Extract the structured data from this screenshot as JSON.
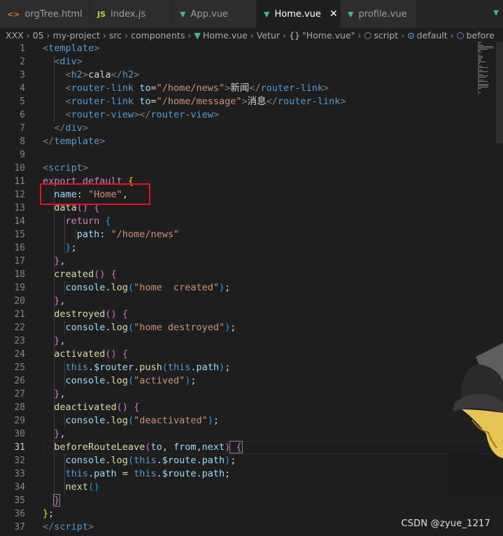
{
  "tabs": [
    {
      "label": "orgTree.html",
      "icon": "html-file-icon",
      "icon_glyph": "<>",
      "active": false
    },
    {
      "label": "index.js",
      "icon": "js-file-icon",
      "icon_glyph": "JS",
      "active": false
    },
    {
      "label": "App.vue",
      "icon": "vue-file-icon",
      "icon_glyph": "▼",
      "active": false
    },
    {
      "label": "Home.vue",
      "icon": "vue-file-icon",
      "icon_glyph": "▼",
      "active": true,
      "close_glyph": "✕"
    },
    {
      "label": "profile.vue",
      "icon": "vue-file-icon",
      "icon_glyph": "▼",
      "active": false
    }
  ],
  "tabbar_right_glyph": "▼",
  "breadcrumb": [
    {
      "label": "XXX"
    },
    {
      "label": "05"
    },
    {
      "label": "my-project"
    },
    {
      "label": "src"
    },
    {
      "label": "components"
    },
    {
      "label": "Home.vue",
      "icon": "vue-file-icon",
      "glyph": "▼"
    },
    {
      "label": "Vetur"
    },
    {
      "label": "\"Home.vue\"",
      "icon": "braces-icon",
      "glyph": "{}"
    },
    {
      "label": "script",
      "icon": "cube-icon",
      "glyph": "⬡"
    },
    {
      "label": "default",
      "icon": "field-icon",
      "glyph": "⊙"
    },
    {
      "label": "before",
      "icon": "method-icon",
      "glyph": "⬡"
    }
  ],
  "breadcrumb_separator": "›",
  "line_numbers": [
    "1",
    "2",
    "3",
    "4",
    "5",
    "6",
    "7",
    "8",
    "9",
    "10",
    "11",
    "12",
    "13",
    "14",
    "15",
    "16",
    "17",
    "18",
    "19",
    "20",
    "21",
    "22",
    "23",
    "24",
    "25",
    "26",
    "27",
    "28",
    "29",
    "30",
    "31",
    "32",
    "33",
    "34",
    "35",
    "36",
    "37"
  ],
  "current_line": "31",
  "code_lines": [
    [
      [
        "t-bracket",
        "<"
      ],
      [
        "t-tag",
        "template"
      ],
      [
        "t-bracket",
        ">"
      ]
    ],
    [
      [
        "",
        "  "
      ],
      [
        "t-bracket",
        "<"
      ],
      [
        "t-tag",
        "div"
      ],
      [
        "t-bracket",
        ">"
      ]
    ],
    [
      [
        "",
        "    "
      ],
      [
        "t-bracket",
        "<"
      ],
      [
        "t-tag",
        "h2"
      ],
      [
        "t-bracket",
        ">"
      ],
      [
        "",
        "cala"
      ],
      [
        "t-bracket",
        "</"
      ],
      [
        "t-tag",
        "h2"
      ],
      [
        "t-bracket",
        ">"
      ]
    ],
    [
      [
        "",
        "    "
      ],
      [
        "t-bracket",
        "<"
      ],
      [
        "t-tag",
        "router-link"
      ],
      [
        "",
        ""
      ],
      [
        "t-attr",
        " to"
      ],
      [
        "",
        "="
      ],
      [
        "t-str",
        "\"/home/news\""
      ],
      [
        "t-bracket",
        ">"
      ],
      [
        "",
        "新闻"
      ],
      [
        "t-bracket",
        "</"
      ],
      [
        "t-tag",
        "router-link"
      ],
      [
        "t-bracket",
        ">"
      ]
    ],
    [
      [
        "",
        "    "
      ],
      [
        "t-bracket",
        "<"
      ],
      [
        "t-tag",
        "router-link"
      ],
      [
        "t-attr",
        " to"
      ],
      [
        "",
        "="
      ],
      [
        "t-str",
        "\"/home/message\""
      ],
      [
        "t-bracket",
        ">"
      ],
      [
        "",
        "消息"
      ],
      [
        "t-bracket",
        "</"
      ],
      [
        "t-tag",
        "router-link"
      ],
      [
        "t-bracket",
        ">"
      ]
    ],
    [
      [
        "",
        "    "
      ],
      [
        "t-bracket",
        "<"
      ],
      [
        "t-tag",
        "router-view"
      ],
      [
        "t-bracket",
        "></"
      ],
      [
        "t-tag",
        "router-view"
      ],
      [
        "t-bracket",
        ">"
      ]
    ],
    [
      [
        "",
        "  "
      ],
      [
        "t-bracket",
        "</"
      ],
      [
        "t-tag",
        "div"
      ],
      [
        "t-bracket",
        ">"
      ]
    ],
    [
      [
        "t-bracket",
        "</"
      ],
      [
        "t-tag",
        "template"
      ],
      [
        "t-bracket",
        ">"
      ]
    ],
    [],
    [
      [
        "t-bracket",
        "<"
      ],
      [
        "t-tag",
        "script"
      ],
      [
        "t-bracket",
        ">"
      ]
    ],
    [
      [
        "t-kw",
        "export default "
      ],
      [
        "t-brace1",
        "{"
      ]
    ],
    [
      [
        "t-var",
        "  name"
      ],
      [
        "",
        ": "
      ],
      [
        "t-str",
        "\"Home\""
      ],
      [
        "",
        ","
      ]
    ],
    [
      [
        "t-fn",
        "  data"
      ],
      [
        "t-brace2",
        "()"
      ],
      [
        "",
        ""
      ],
      [
        "t-brace2",
        " {"
      ]
    ],
    [
      [
        "t-kw",
        "    return "
      ],
      [
        "t-brace3",
        "{"
      ]
    ],
    [
      [
        "t-var",
        "      path"
      ],
      [
        "",
        ": "
      ],
      [
        "t-str",
        "\"/home/news\""
      ]
    ],
    [
      [
        "t-brace3",
        "    }"
      ],
      [
        "",
        ";"
      ]
    ],
    [
      [
        "t-brace2",
        "  }"
      ],
      [
        "",
        ","
      ]
    ],
    [
      [
        "t-fn",
        "  created"
      ],
      [
        "t-brace2",
        "()"
      ],
      [
        "t-brace2",
        " {"
      ]
    ],
    [
      [
        "t-var",
        "    console"
      ],
      [
        "",
        "."
      ],
      [
        "t-fn",
        "log"
      ],
      [
        "t-brace3",
        "("
      ],
      [
        "t-str",
        "\"home  created\""
      ],
      [
        "t-brace3",
        ")"
      ],
      [
        "",
        ";"
      ]
    ],
    [
      [
        "t-brace2",
        "  }"
      ],
      [
        "",
        ","
      ]
    ],
    [
      [
        "t-fn",
        "  destroyed"
      ],
      [
        "t-brace2",
        "()"
      ],
      [
        "t-brace2",
        " {"
      ]
    ],
    [
      [
        "t-var",
        "    console"
      ],
      [
        "",
        "."
      ],
      [
        "t-fn",
        "log"
      ],
      [
        "t-brace3",
        "("
      ],
      [
        "t-str",
        "\"home destroyed\""
      ],
      [
        "t-brace3",
        ")"
      ],
      [
        "",
        ";"
      ]
    ],
    [
      [
        "t-brace2",
        "  }"
      ],
      [
        "",
        ","
      ]
    ],
    [
      [
        "t-fn",
        "  activated"
      ],
      [
        "t-brace2",
        "()"
      ],
      [
        "t-brace2",
        " {"
      ]
    ],
    [
      [
        "t-this",
        "    this"
      ],
      [
        "",
        "."
      ],
      [
        "t-var",
        "$router"
      ],
      [
        "",
        "."
      ],
      [
        "t-fn",
        "push"
      ],
      [
        "t-brace3",
        "("
      ],
      [
        "t-this",
        "this"
      ],
      [
        "",
        "."
      ],
      [
        "t-var",
        "path"
      ],
      [
        "t-brace3",
        ")"
      ],
      [
        "",
        ";"
      ]
    ],
    [
      [
        "t-var",
        "    console"
      ],
      [
        "",
        "."
      ],
      [
        "t-fn",
        "log"
      ],
      [
        "t-brace3",
        "("
      ],
      [
        "t-str",
        "\"actived\""
      ],
      [
        "t-brace3",
        ")"
      ],
      [
        "",
        ";"
      ]
    ],
    [
      [
        "t-brace2",
        "  }"
      ],
      [
        "",
        ","
      ]
    ],
    [
      [
        "t-fn",
        "  deactivated"
      ],
      [
        "t-brace2",
        "()"
      ],
      [
        "t-brace2",
        " {"
      ]
    ],
    [
      [
        "t-var",
        "    console"
      ],
      [
        "",
        "."
      ],
      [
        "t-fn",
        "log"
      ],
      [
        "t-brace3",
        "("
      ],
      [
        "t-str",
        "\"deactivated\""
      ],
      [
        "t-brace3",
        ")"
      ],
      [
        "",
        ";"
      ]
    ],
    [
      [
        "t-brace2",
        "  }"
      ],
      [
        "",
        ","
      ]
    ],
    [
      [
        "t-fn",
        "  beforeRouteLeave"
      ],
      [
        "t-brace2",
        "("
      ],
      [
        "t-var",
        "to"
      ],
      [
        "",
        ", "
      ],
      [
        "t-var",
        "from"
      ],
      [
        "",
        ","
      ],
      [
        "t-var",
        "next"
      ],
      [
        "t-brace2",
        ")"
      ],
      [
        "",
        ""
      ],
      [
        "t-brace2 matched",
        " {"
      ]
    ],
    [
      [
        "t-var",
        "    console"
      ],
      [
        "",
        "."
      ],
      [
        "t-fn",
        "log"
      ],
      [
        "t-brace3",
        "("
      ],
      [
        "t-this",
        "this"
      ],
      [
        "",
        "."
      ],
      [
        "t-var",
        "$route"
      ],
      [
        "",
        "."
      ],
      [
        "t-var",
        "path"
      ],
      [
        "t-brace3",
        ")"
      ],
      [
        "",
        ";"
      ]
    ],
    [
      [
        "t-this",
        "    this"
      ],
      [
        "",
        "."
      ],
      [
        "t-var",
        "path"
      ],
      [
        "t-punc",
        " = "
      ],
      [
        "t-this",
        "this"
      ],
      [
        "",
        "."
      ],
      [
        "t-var",
        "$route"
      ],
      [
        "",
        "."
      ],
      [
        "t-var",
        "path"
      ],
      [
        "",
        ";"
      ]
    ],
    [
      [
        "t-fn",
        "    next"
      ],
      [
        "t-brace3",
        "()"
      ]
    ],
    [
      [
        "",
        "  "
      ],
      [
        "t-brace2 matched",
        "}"
      ]
    ],
    [
      [
        "t-brace1",
        "}"
      ],
      [
        "",
        ";"
      ]
    ],
    [
      [
        "t-bracket",
        "</"
      ],
      [
        "t-tag",
        "script"
      ],
      [
        "t-bracket",
        ">"
      ]
    ]
  ],
  "watermark": "CSDN @zyue_1217",
  "colors": {
    "highlight_box": "#e81123",
    "vue_green": "#41b883"
  }
}
